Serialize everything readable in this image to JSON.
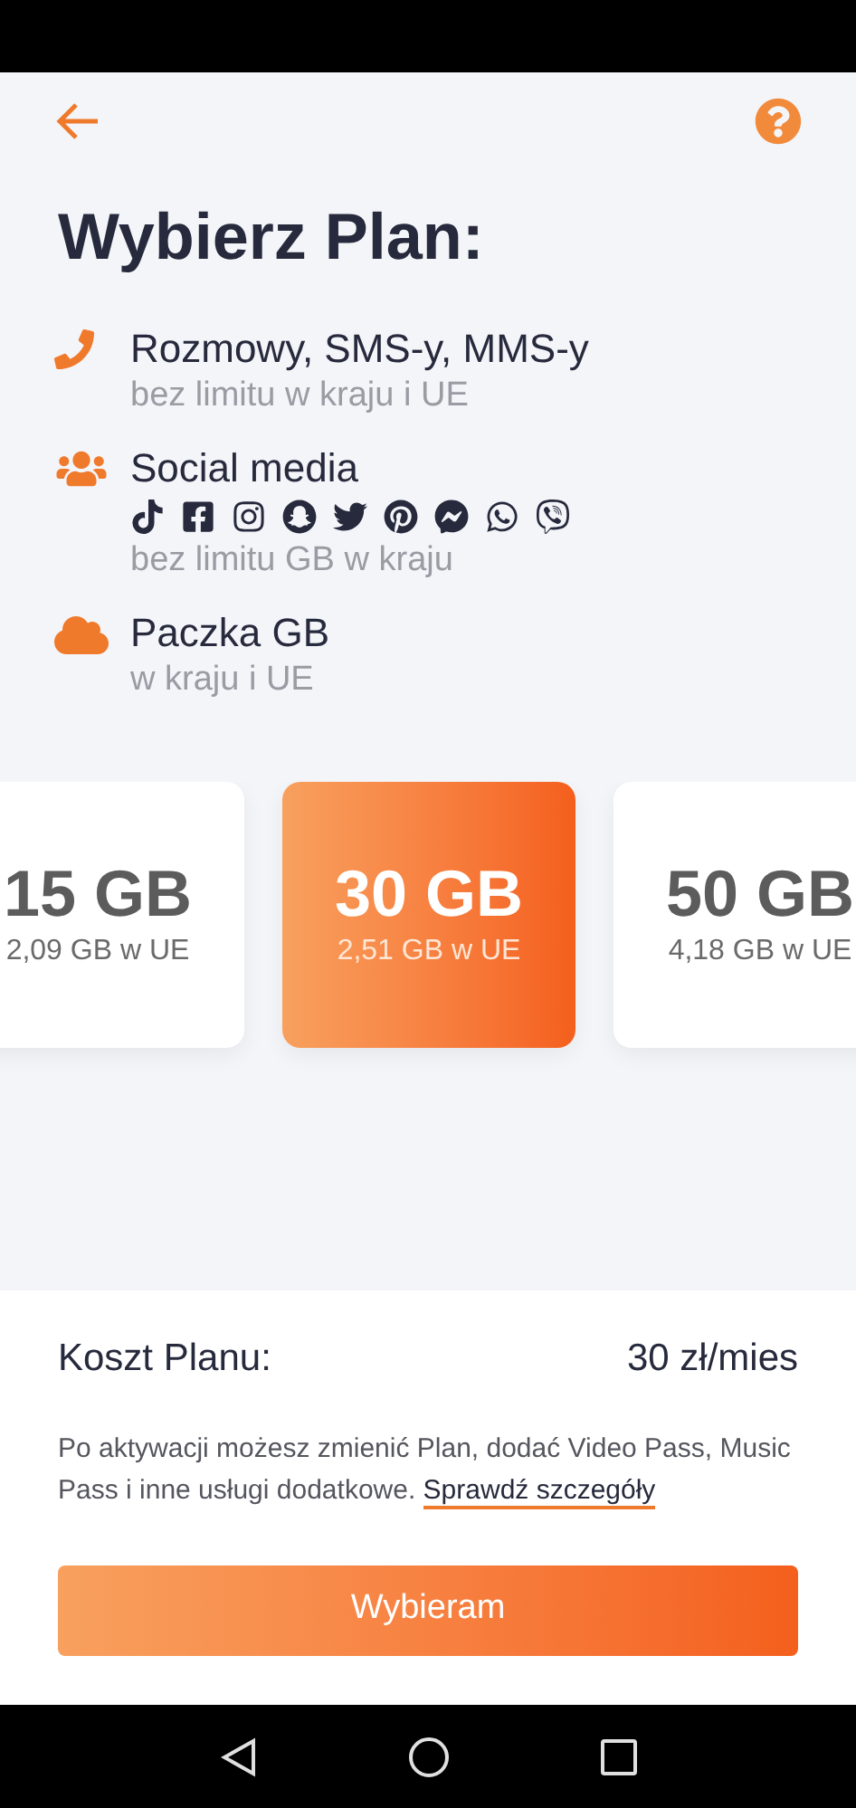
{
  "title": "Wybierz Plan:",
  "features": [
    {
      "kind": "calls",
      "title": "Rozmowy, SMS-y, MMS-y",
      "subtitle": "bez limitu w kraju i UE"
    },
    {
      "kind": "social",
      "title": "Social media",
      "subtitle": "bez limitu GB w kraju"
    },
    {
      "kind": "data",
      "title": "Paczka GB",
      "subtitle": "w kraju i UE"
    }
  ],
  "plans": [
    {
      "amount": "15 GB",
      "eu": "2,09 GB w UE",
      "selected": false
    },
    {
      "amount": "30 GB",
      "eu": "2,51 GB w UE",
      "selected": true
    },
    {
      "amount": "50 GB",
      "eu": "4,18 GB w UE",
      "selected": false
    }
  ],
  "cost": {
    "label": "Koszt Planu:",
    "value": "30 zł/mies"
  },
  "note": {
    "text": "Po aktywacji możesz zmienić Plan, dodać Video Pass, Music Pass i inne usługi dodatkowe.",
    "link": "Sprawdź szczegóły"
  },
  "button": "Wybieram"
}
